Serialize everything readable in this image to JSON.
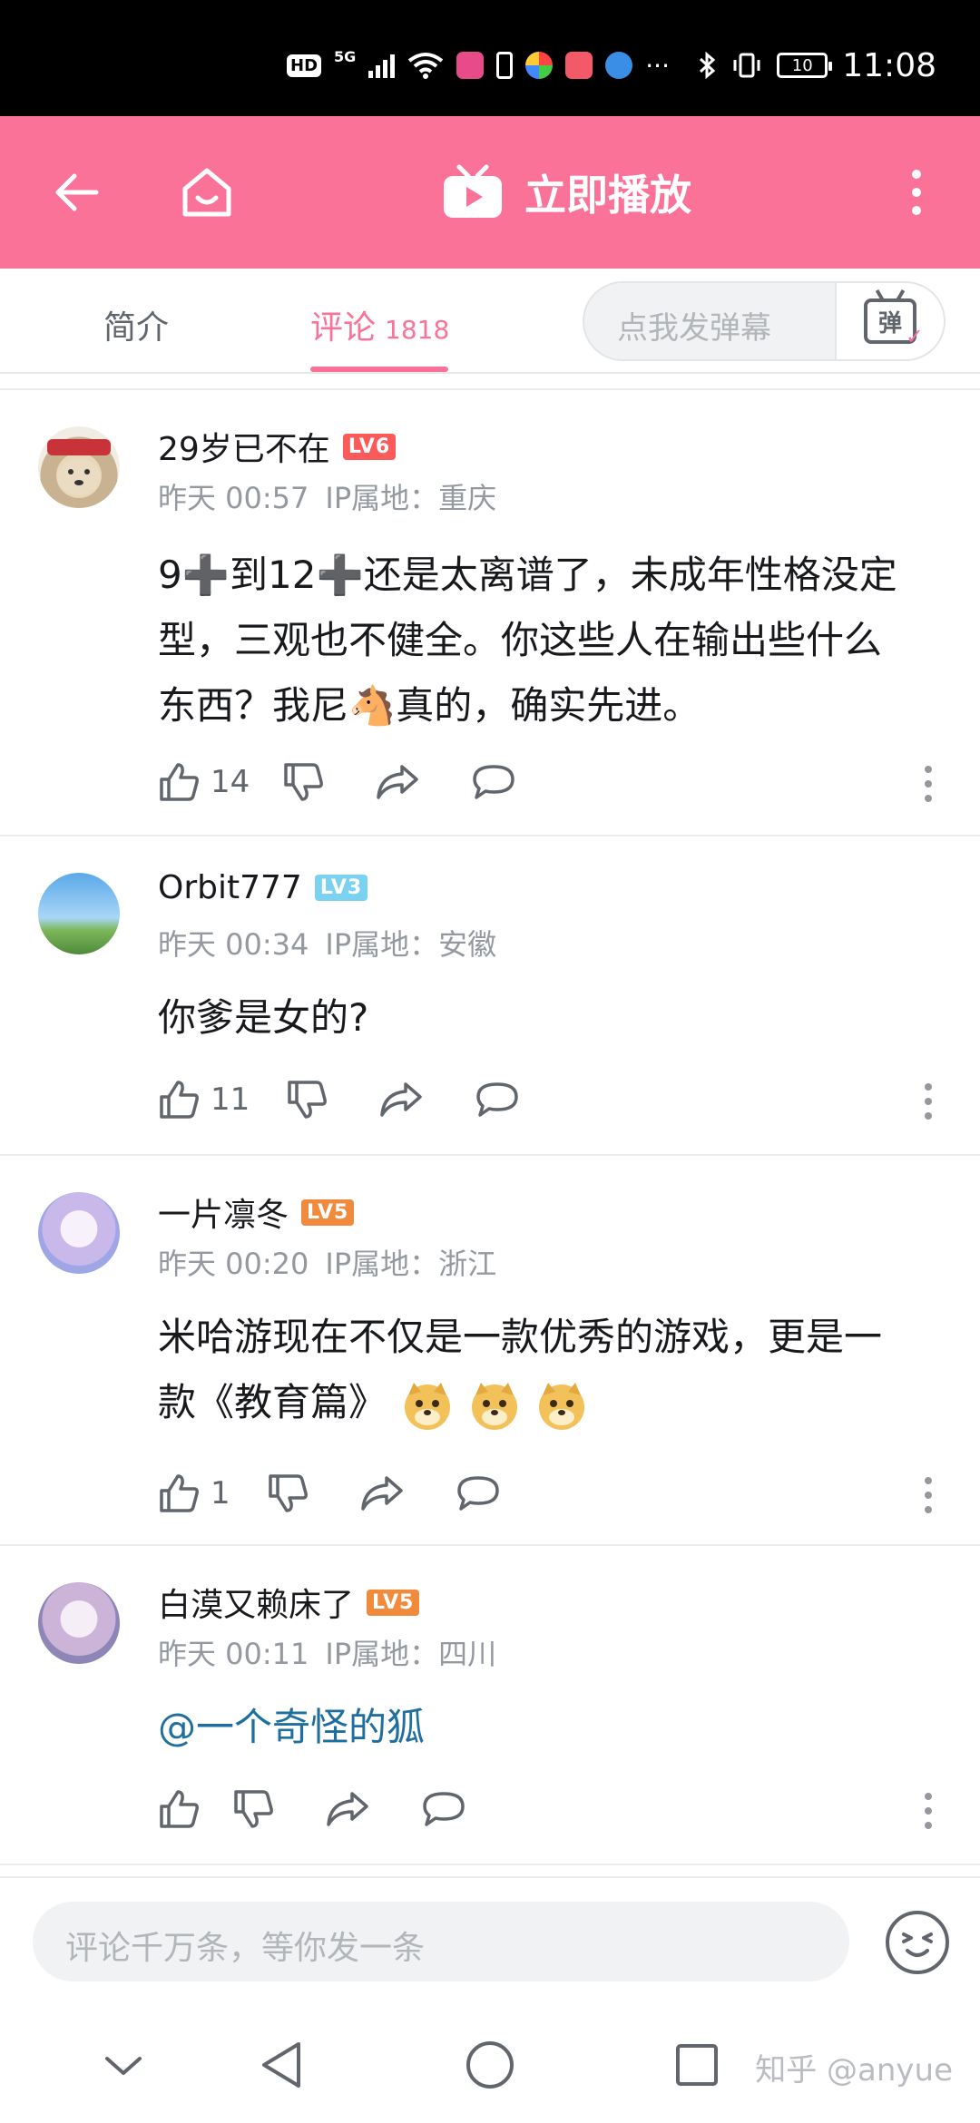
{
  "status_bar": {
    "hd_label": "HD",
    "network_label": "5G",
    "battery_level": "10",
    "time": "11:08"
  },
  "app_bar": {
    "play_now_label": "立即播放",
    "accent_color": "#fb7299"
  },
  "tabs": {
    "intro_label": "简介",
    "comments_label": "评论",
    "comments_count": "1818",
    "danmaku_placeholder": "点我发弹幕",
    "danmaku_toggle_label": "弹"
  },
  "comments": [
    {
      "username": "29岁已不在",
      "level": "LV6",
      "level_color": "#fb5a5a",
      "time": "昨天 00:57",
      "ip": "IP属地：重庆",
      "text_lines": [
        "9➕到12➕还是太离谱了，未成年性格没定",
        "型，三观也不健全。你这些人在输出些什么",
        "东西？我尼🐴真的，确实先进。"
      ],
      "likes": "14"
    },
    {
      "username": "Orbit777",
      "level": "LV3",
      "level_color": "#7bd1f0",
      "time": "昨天 00:34",
      "ip": "IP属地：安徽",
      "text_lines": [
        "你爹是女的?"
      ],
      "likes": "11"
    },
    {
      "username": "一片凛冬",
      "level": "LV5",
      "level_color": "#f08a3c",
      "time": "昨天 00:20",
      "ip": "IP属地：浙江",
      "text_lines": [
        "米哈游现在不仅是一款优秀的游戏，更是一",
        "款《教育篇》"
      ],
      "likes": "1"
    },
    {
      "username": "白漠又赖床了",
      "level": "LV5",
      "level_color": "#f08a3c",
      "time": "昨天 00:11",
      "ip": "IP属地：四川",
      "text_lines": [
        "@一个奇怪的狐"
      ],
      "likes": ""
    }
  ],
  "bottom_bar": {
    "comment_placeholder": "评论千万条，等你发一条"
  },
  "watermark": "知乎 @anyue"
}
